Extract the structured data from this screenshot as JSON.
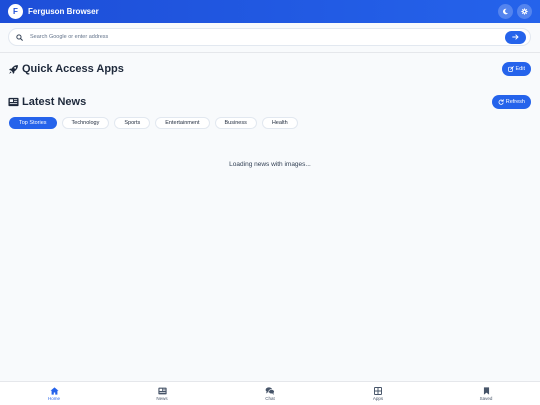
{
  "header": {
    "avatar_letter": "F",
    "title": "Ferguson Browser",
    "icons": [
      "moon-icon",
      "gear-icon"
    ]
  },
  "search": {
    "placeholder": "Search Google or enter address",
    "go_icon": "arrow-right-icon"
  },
  "quick_access": {
    "icon": "rocket-icon",
    "title": "Quick Access Apps",
    "edit_label": "Edit"
  },
  "news": {
    "icon": "newspaper-icon",
    "title": "Latest News",
    "refresh_label": "Refresh",
    "categories": [
      "Top Stories",
      "Technology",
      "Sports",
      "Entertainment",
      "Business",
      "Health"
    ],
    "active_category": "Top Stories",
    "loading_text": "Loading news with images..."
  },
  "bottom_nav": {
    "items": [
      "Home",
      "News",
      "Chat",
      "Apps",
      "Saved"
    ],
    "active": "Home"
  },
  "colors": {
    "accent": "#2563eb",
    "header_from": "#1d4ed8",
    "background": "#f8fafc"
  }
}
